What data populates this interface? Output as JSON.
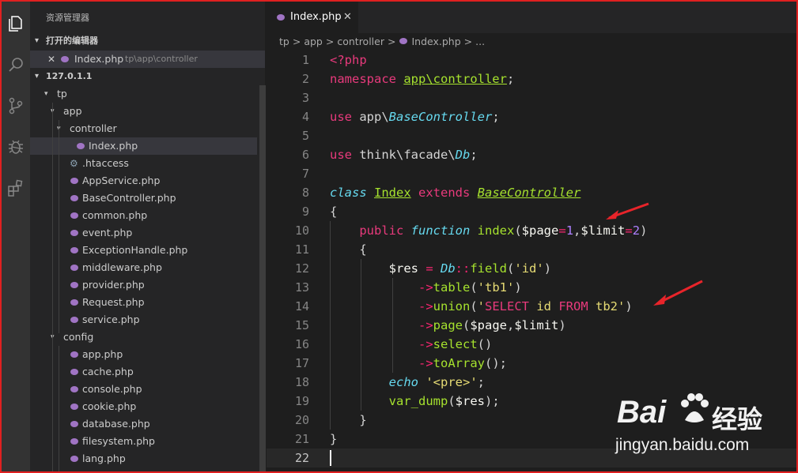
{
  "sidebar": {
    "title": "资源管理器",
    "open_editors_label": "打开的编辑器",
    "open_editor": {
      "name": "Index.php",
      "path": "tp\\app\\controller"
    },
    "workspace_label": "127.0.1.1",
    "tree": [
      {
        "label": "tp",
        "kind": "folder"
      },
      {
        "label": "app",
        "kind": "folder"
      },
      {
        "label": "controller",
        "kind": "folder"
      },
      {
        "label": "Index.php",
        "kind": "php"
      },
      {
        "label": ".htaccess",
        "kind": "gear"
      },
      {
        "label": "AppService.php",
        "kind": "php"
      },
      {
        "label": "BaseController.php",
        "kind": "php"
      },
      {
        "label": "common.php",
        "kind": "php"
      },
      {
        "label": "event.php",
        "kind": "php"
      },
      {
        "label": "ExceptionHandle.php",
        "kind": "php"
      },
      {
        "label": "middleware.php",
        "kind": "php"
      },
      {
        "label": "provider.php",
        "kind": "php"
      },
      {
        "label": "Request.php",
        "kind": "php"
      },
      {
        "label": "service.php",
        "kind": "php"
      },
      {
        "label": "config",
        "kind": "folder"
      },
      {
        "label": "app.php",
        "kind": "php"
      },
      {
        "label": "cache.php",
        "kind": "php"
      },
      {
        "label": "console.php",
        "kind": "php"
      },
      {
        "label": "cookie.php",
        "kind": "php"
      },
      {
        "label": "database.php",
        "kind": "php"
      },
      {
        "label": "filesystem.php",
        "kind": "php"
      },
      {
        "label": "lang.php",
        "kind": "php"
      }
    ]
  },
  "editor": {
    "tab_label": "Index.php",
    "close_glyph": "✕",
    "breadcrumb": [
      "tp",
      ">",
      "app",
      ">",
      "controller",
      ">",
      "Index.php",
      ">",
      "..."
    ],
    "line_numbers": [
      "1",
      "2",
      "3",
      "4",
      "5",
      "6",
      "7",
      "8",
      "9",
      "10",
      "11",
      "12",
      "13",
      "14",
      "15",
      "16",
      "17",
      "18",
      "19",
      "20",
      "21",
      "22"
    ],
    "lines": [
      [
        [
          "<?php",
          "kw"
        ]
      ],
      [
        [
          "namespace ",
          "kw"
        ],
        [
          "app\\controller",
          "ns"
        ],
        [
          ";",
          "d"
        ]
      ],
      [],
      [
        [
          "use ",
          "kw"
        ],
        [
          "app\\",
          "d"
        ],
        [
          "BaseController",
          "cls"
        ],
        [
          ";",
          "d"
        ]
      ],
      [],
      [
        [
          "use ",
          "kw"
        ],
        [
          "think\\facade\\",
          "d"
        ],
        [
          "Db",
          "cls"
        ],
        [
          ";",
          "d"
        ]
      ],
      [],
      [
        [
          "class ",
          "kwi"
        ],
        [
          "Index",
          "ns"
        ],
        [
          " extends ",
          "kw"
        ],
        [
          "BaseController",
          "cls2"
        ]
      ],
      [
        [
          "{",
          "d"
        ]
      ],
      [
        [
          "    public ",
          "kw"
        ],
        [
          "function ",
          "kwi"
        ],
        [
          "index",
          "fn"
        ],
        [
          "(",
          "d"
        ],
        [
          "$page",
          "var"
        ],
        [
          "=",
          "op"
        ],
        [
          "1",
          "num"
        ],
        [
          ",",
          "d"
        ],
        [
          "$limit",
          "var"
        ],
        [
          "=",
          "op"
        ],
        [
          "2",
          "num"
        ],
        [
          ")",
          "d"
        ]
      ],
      [
        [
          "    {",
          "d"
        ]
      ],
      [
        [
          "        $res ",
          "var"
        ],
        [
          "= ",
          "op"
        ],
        [
          "Db",
          "cls"
        ],
        [
          "::",
          "op"
        ],
        [
          "field",
          "fn"
        ],
        [
          "(",
          "d"
        ],
        [
          "'id'",
          "str"
        ],
        [
          ")",
          "d"
        ]
      ],
      [
        [
          "            ->",
          "op"
        ],
        [
          "table",
          "fn"
        ],
        [
          "(",
          "d"
        ],
        [
          "'tb1'",
          "str"
        ],
        [
          ")",
          "d"
        ]
      ],
      [
        [
          "            ->",
          "op"
        ],
        [
          "union",
          "fn"
        ],
        [
          "(",
          "d"
        ],
        [
          "'",
          "str"
        ],
        [
          "SELECT ",
          "sql"
        ],
        [
          "id ",
          "str"
        ],
        [
          "FROM ",
          "sql"
        ],
        [
          "tb2'",
          "str"
        ],
        [
          ")",
          "d"
        ]
      ],
      [
        [
          "            ->",
          "op"
        ],
        [
          "page",
          "fn"
        ],
        [
          "(",
          "d"
        ],
        [
          "$page",
          "var"
        ],
        [
          ",",
          "d"
        ],
        [
          "$limit",
          "var"
        ],
        [
          ")",
          "d"
        ]
      ],
      [
        [
          "            ->",
          "op"
        ],
        [
          "select",
          "fn"
        ],
        [
          "()",
          "d"
        ]
      ],
      [
        [
          "            ->",
          "op"
        ],
        [
          "toArray",
          "fn"
        ],
        [
          "();",
          "d"
        ]
      ],
      [
        [
          "        echo ",
          "kwi"
        ],
        [
          "'<pre>'",
          "str"
        ],
        [
          ";",
          "d"
        ]
      ],
      [
        [
          "        var_dump",
          "fn"
        ],
        [
          "(",
          "d"
        ],
        [
          "$res",
          "var"
        ],
        [
          ");",
          "d"
        ]
      ],
      [
        [
          "    }",
          "d"
        ]
      ],
      [
        [
          "}",
          "d"
        ]
      ],
      []
    ]
  },
  "watermark": {
    "brand_left": "Bai",
    "brand_right": "经验",
    "url": "jingyan.baidu.com"
  },
  "colors": {
    "frame": "#e02020",
    "arrow": "#e8242a",
    "accent": "#a6e22e"
  }
}
